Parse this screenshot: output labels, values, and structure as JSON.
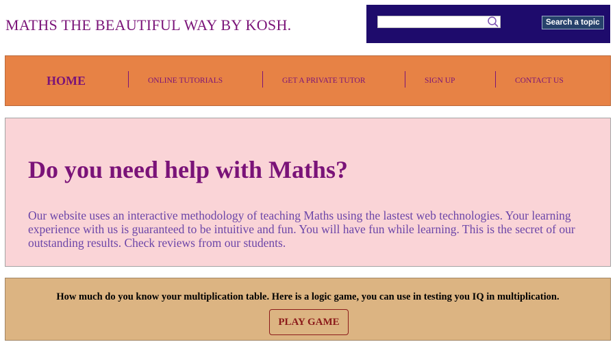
{
  "header": {
    "site_title": "MATHS THE BEAUTIFUL WAY BY KOSH."
  },
  "search": {
    "value": "",
    "placeholder": "",
    "button_label": "Search a topic",
    "icon": "search-icon"
  },
  "nav": {
    "items": [
      {
        "label": "HOME"
      },
      {
        "label": "ONLINE TUTORIALS"
      },
      {
        "label": "GET A PRIVATE TUTOR"
      },
      {
        "label": "SIGN UP"
      },
      {
        "label": "CONTACT US"
      }
    ]
  },
  "hero": {
    "title": "Do you need help with Maths?",
    "body": "Our website uses an interactive methodology of teaching Maths using the lastest web technologies. Your learning experience with us is guaranteed to be intuitive and fun. You will have fun while learning. This is the secret of our outstanding results. Check reviews from our students."
  },
  "game": {
    "text": "How much do you know your multiplication table. Here is a logic game, you can use in testing you IQ in multiplication.",
    "button_label": "PLAY GAME"
  },
  "colors": {
    "brand_purple": "#7a1378",
    "search_panel": "#1e0b6c",
    "nav_background": "#e78245",
    "hero_background": "#fad4d7",
    "hero_text": "#6b45a8",
    "game_background": "#dcb482",
    "game_button": "#8b1a1a"
  }
}
